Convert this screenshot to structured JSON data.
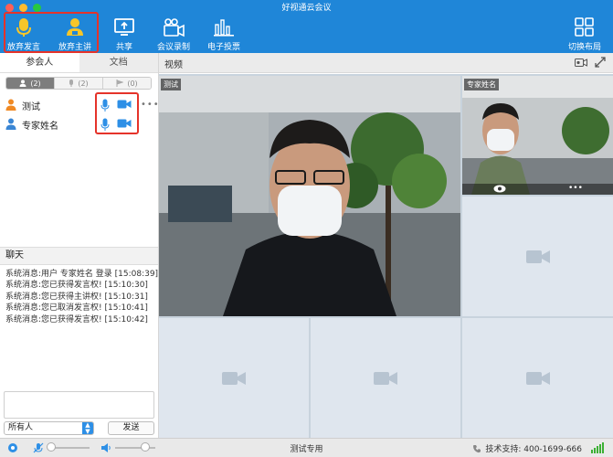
{
  "window": {
    "title": "好视通云会议"
  },
  "toolbar": {
    "give_up_speaking": "放弃发言",
    "give_up_presenting": "放弃主讲",
    "share": "共享",
    "record": "会议录制",
    "vote": "电子投票",
    "layout": "切换布局"
  },
  "left": {
    "tabs": [
      "参会人",
      "文档"
    ],
    "filters": [
      "(2)",
      "(2)",
      "(0)"
    ],
    "members": [
      {
        "name": "测试"
      },
      {
        "name": "专家姓名"
      }
    ],
    "more": "•••"
  },
  "chat": {
    "title": "聊天",
    "lines": [
      "系统消息:用户 专家姓名 登录 [15:08:39]",
      "系统消息:您已获得发言权! [15:10:30]",
      "系统消息:您已获得主讲权! [15:10:31]",
      "系统消息:您已取消发言权! [15:10:41]",
      "系统消息:您已获得发言权! [15:10:42]"
    ],
    "recipient": "所有人",
    "send": "发送"
  },
  "video": {
    "header": "视频",
    "main_label": "测试",
    "side_label": "专家姓名"
  },
  "status": {
    "center": "测试专用",
    "support": "技术支持:  400-1699-666",
    "mic_volume": 0.05,
    "speaker_volume": 0.75
  },
  "colors": {
    "brand": "#1f86d8",
    "highlight_box": "#e5332a",
    "mic_yellow": "#f6c629",
    "icon_blue": "#2d8fe6",
    "empty_tile": "#dfe6ee"
  }
}
